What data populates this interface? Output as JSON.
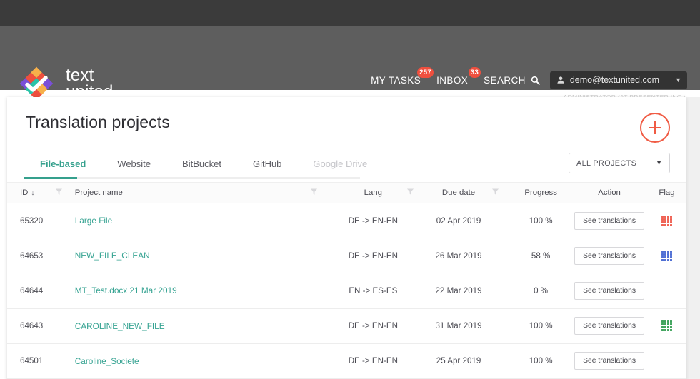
{
  "brand": {
    "logo_line1": "text",
    "logo_line2": "united",
    "logo_icon": "diamond-grid-check-logo"
  },
  "header": {
    "my_tasks_label": "MY TASKS",
    "my_tasks_badge": "257",
    "inbox_label": "INBOX",
    "inbox_badge": "33",
    "search_label": "SEARCH",
    "search_icon": "search-icon",
    "user_icon": "user-icon",
    "user_email": "demo@textunited.com",
    "user_caret": "▼",
    "user_role": "ADMINISTRATOR (AT PRESENTER INC.)"
  },
  "card": {
    "title": "Translation projects",
    "add_button_icon": "plus-icon",
    "tabs": [
      {
        "label": "File-based",
        "state": "active"
      },
      {
        "label": "Website",
        "state": "default"
      },
      {
        "label": "BitBucket",
        "state": "default"
      },
      {
        "label": "GitHub",
        "state": "default"
      },
      {
        "label": "Google Drive",
        "state": "disabled"
      }
    ],
    "projects_filter": {
      "value": "ALL PROJECTS",
      "caret": "▼"
    }
  },
  "table": {
    "columns": {
      "id": "ID",
      "id_sort": "↓",
      "project_name": "Project name",
      "lang": "Lang",
      "due_date": "Due date",
      "progress": "Progress",
      "action": "Action",
      "flag": "Flag"
    },
    "filter_icon": "funnel-filter-icon",
    "action_button_label": "See translations",
    "rows": [
      {
        "id": "65320",
        "name": "Large File",
        "lang": "DE -> EN-EN",
        "due": "02 Apr 2019",
        "progress": "100 %",
        "action": "See translations",
        "flag_color": "#ef6254"
      },
      {
        "id": "64653",
        "name": "NEW_FILE_CLEAN",
        "lang": "DE -> EN-EN",
        "due": "26 Mar 2019",
        "progress": "58 %",
        "action": "See translations",
        "flag_color": "#4f6fd4"
      },
      {
        "id": "64644",
        "name": "MT_Test.docx 21 Mar 2019",
        "lang": "EN -> ES-ES",
        "due": "22 Mar 2019",
        "progress": "0 %",
        "action": "See translations",
        "flag_color": ""
      },
      {
        "id": "64643",
        "name": "CAROLINE_NEW_FILE",
        "lang": "DE -> EN-EN",
        "due": "31 Mar 2019",
        "progress": "100 %",
        "action": "See translations",
        "flag_color": "#3fa35c"
      },
      {
        "id": "64501",
        "name": "Caroline_Societe",
        "lang": "DE -> EN-EN",
        "due": "25 Apr 2019",
        "progress": "100 %",
        "action": "See translations",
        "flag_color": ""
      }
    ]
  },
  "colors": {
    "topbar": "#3b3b3b",
    "header": "#5e5e5e",
    "accent_teal": "#35a08d",
    "accent_orange": "#f05b44",
    "badge_red": "#ef4f3e"
  }
}
